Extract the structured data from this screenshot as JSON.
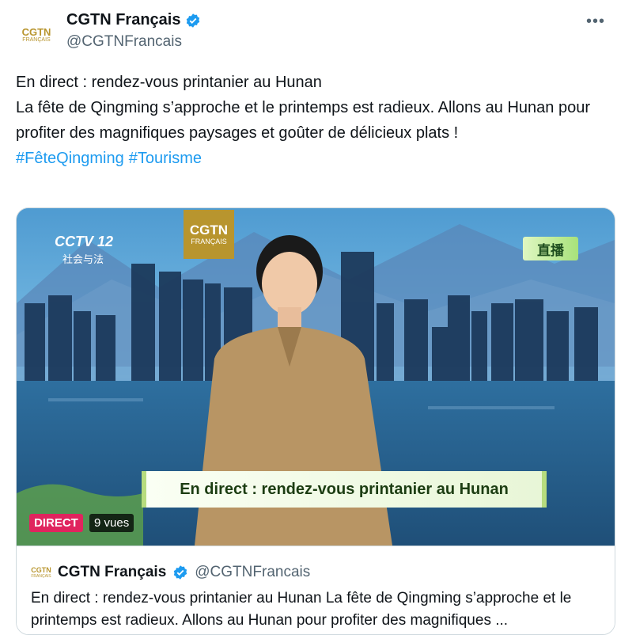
{
  "tweet": {
    "display_name": "CGTN Français",
    "handle": "@CGTNFrancais",
    "more_label": "•••",
    "avatar_main": "CGTN",
    "avatar_sub": "FRANÇAIS",
    "lines": [
      "En direct : rendez-vous printanier au Hunan",
      "La fête de Qingming s’approche et le printemps est radieux. Allons au Hunan pour profiter des magnifiques paysages et goûter de délicieux plats !"
    ],
    "hashtags": [
      "#FêteQingming",
      "#Tourisme"
    ]
  },
  "media": {
    "cctv_label": "CCTV 12",
    "cctv_sub": "社会与法",
    "logo_main": "CGTN",
    "logo_sub": "FRANÇAIS",
    "live_tag": "直播",
    "banner_text": "En direct : rendez-vous printanier au Hunan",
    "direct_badge": "DIRECT",
    "views": "9 vues"
  },
  "quote": {
    "avatar_main": "CGTN",
    "avatar_sub": "FRANÇAIS",
    "display_name": "CGTN Français",
    "handle": "@CGTNFrancais",
    "text": "En direct : rendez-vous printanier au Hunan La fête de Qingming s’approche et le printemps est radieux. Allons au Hunan pour profiter des magnifiques ..."
  },
  "colors": {
    "link": "#1d9bf0",
    "verified": "#1d9bf0",
    "brand_gold": "#b8952e",
    "live_red": "#e0245e"
  }
}
